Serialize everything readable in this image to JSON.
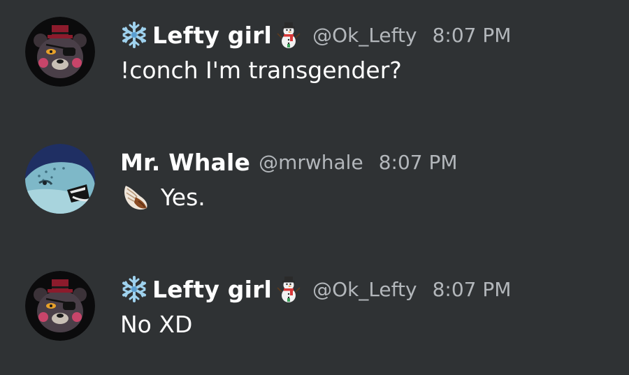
{
  "messages": [
    {
      "author": "Lefty girl",
      "handle": "@Ok_Lefty",
      "time": "8:07 PM",
      "content": "!conch I'm transgender?",
      "avatar": "bear-avatar",
      "name_prefix_icon": "snowflake-icon",
      "name_suffix_icon": "snowman-icon"
    },
    {
      "author": "Mr. Whale",
      "handle": "@mrwhale",
      "time": "8:07 PM",
      "content": "Yes.",
      "avatar": "whale-avatar",
      "content_prefix_icon": "conch-shell-icon"
    },
    {
      "author": "Lefty girl",
      "handle": "@Ok_Lefty",
      "time": "8:07 PM",
      "content": "No XD",
      "avatar": "bear-avatar",
      "name_prefix_icon": "snowflake-icon",
      "name_suffix_icon": "snowman-icon"
    }
  ]
}
